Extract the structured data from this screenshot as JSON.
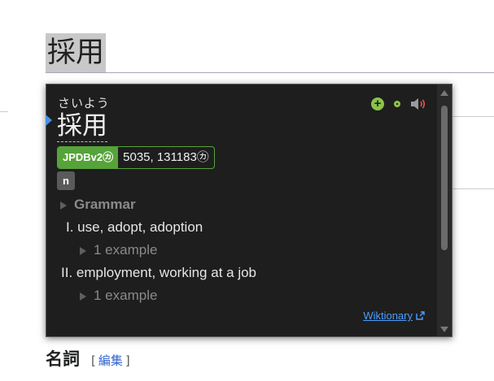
{
  "page": {
    "heading": "採用",
    "section_title": "名詞",
    "edit_open": "[",
    "edit_label": "編集",
    "edit_close": "]"
  },
  "popup": {
    "reading": "さいよう",
    "term": "採用",
    "frequency": {
      "dictionary": "JPDBv2㋕",
      "value": "5035, 131183㋕"
    },
    "part_of_speech": "n",
    "grammar_label": "Grammar",
    "senses": [
      {
        "text": "I. use, adopt, adoption",
        "example": "1 example"
      },
      {
        "text": "II. employment, working at a job",
        "example": "1 example"
      }
    ],
    "source_link": "Wiktionary",
    "icons": {
      "add": "add-note-icon",
      "add_small": "add-icon",
      "audio": "speaker-icon",
      "external": "external-link-icon"
    },
    "colors": {
      "background": "#1e1e1e",
      "frequency_tag": "#56a33a",
      "add_button": "#8bc34a",
      "audio_waves": "#e05555",
      "link": "#4a9eff",
      "marker": "#4a90e2"
    }
  }
}
